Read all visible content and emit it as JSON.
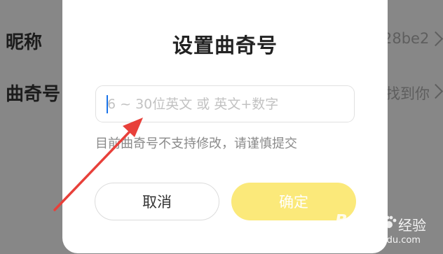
{
  "background": {
    "rows": [
      {
        "label": "昵称",
        "value": "28be2"
      },
      {
        "label": "曲奇号",
        "value": "找到你"
      }
    ]
  },
  "dialog": {
    "title": "设置曲奇号",
    "input": {
      "value": "",
      "placeholder": "6 ~ 30位英文 或 英文+数字"
    },
    "hint": "目前曲奇号不支持修改，请谨慎提交",
    "cancel_label": "取消",
    "confirm_label": "确定"
  },
  "colors": {
    "overlay": "#878787",
    "confirm_button": "#fbe97a",
    "arrow": "#e8403a"
  },
  "watermark": {
    "brand": "Bai",
    "brand_suffix": "经验",
    "url": "jingyan.baidu.com"
  }
}
